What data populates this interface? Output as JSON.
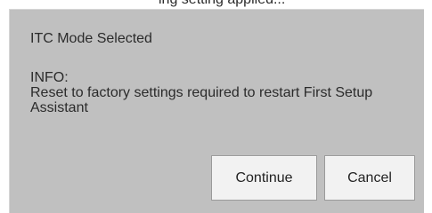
{
  "background_partial_text": "ing setting applied...",
  "dialog": {
    "title": "ITC Mode Selected",
    "info_heading": "INFO:",
    "info_message": "Reset to factory settings required to restart First Setup Assistant",
    "buttons": {
      "continue_label": "Continue",
      "cancel_label": "Cancel"
    }
  },
  "colors": {
    "dialog_background": "#c0c0c0",
    "button_background": "#f2f2f2",
    "text": "#2b2b2b"
  }
}
